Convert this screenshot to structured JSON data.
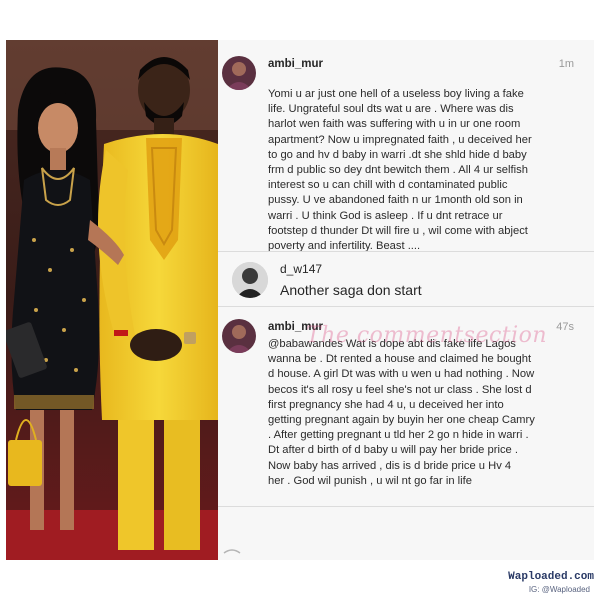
{
  "comments": [
    {
      "username": "ambi_mur",
      "time": "1m",
      "lines": [
        "Yomi u ar just one hell of a useless boy living a fake",
        "life. Ungrateful soul dts wat u are . Where was dis",
        "harlot wen faith was suffering with u in ur one room",
        "apartment? Now u impregnated faith , u deceived her",
        "to go and hv d baby in warri .dt she shld hide d baby",
        "frm d public so dey dnt bewitch them . All 4 ur selfish",
        "interest so u can chill with d contaminated public",
        "pussy. U ve abandoned faith n ur 1month old son in",
        "warri . U think God is asleep . If u dnt retrace ur",
        "footstep d thunder Dt will fire u , wil come with abject",
        "poverty and infertility. Beast ...."
      ]
    },
    {
      "username": "d_w147",
      "text": "Another saga don start"
    },
    {
      "username": "ambi_mur",
      "time": "47s",
      "lines": [
        "@babawandes Wat is dope abt dis fake life Lagos",
        "wanna be . Dt rented a house and claimed he bought",
        "d house. A girl Dt was with u wen u had nothing . Now",
        "becos it's all rosy u feel she's not ur class . She lost d",
        "first pregnancy she had 4 u, u deceived her into",
        "getting pregnant again by buyin her one cheap Camry",
        ". After getting pregnant u tld her 2 go n hide in warri .",
        "Dt after d birth of d baby u will pay her bride price .",
        "Now baby has arrived , dis is d bride price u Hv 4",
        "her . God wil punish , u wil nt go far in life"
      ]
    }
  ],
  "watermark": "The commentsection",
  "credit": {
    "site": "Waploaded.com",
    "ig": "IG: @Waploaded"
  },
  "colors": {
    "panel_bg": "#f7f7f7",
    "username": "#262626",
    "time": "#9a9a9a",
    "watermark": "#dc5a8c",
    "dress_yellow": "#f2cf2a"
  }
}
